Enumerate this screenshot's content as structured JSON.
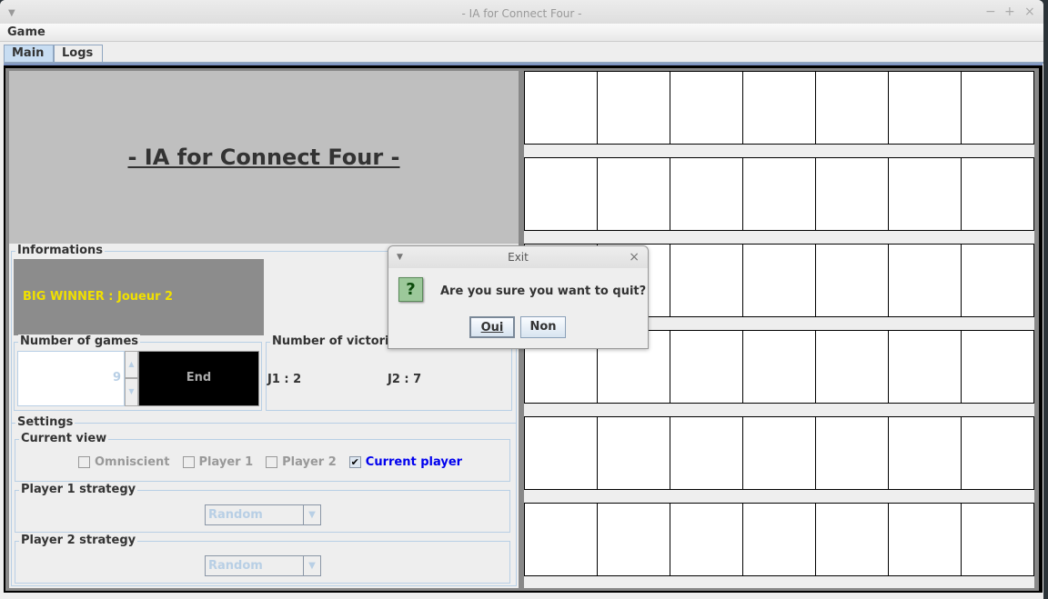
{
  "window": {
    "title": "- IA for Connect Four -",
    "controls": {
      "minimize": "−",
      "maximize": "+",
      "close": "×"
    }
  },
  "menu": {
    "items": [
      {
        "label": "Game"
      }
    ]
  },
  "tabs": [
    {
      "label": "Main",
      "active": true
    },
    {
      "label": "Logs",
      "active": false
    }
  ],
  "main": {
    "title": "- IA for Connect Four -",
    "informations": {
      "label": "Informations",
      "winner_text": "BIG WINNER : Joueur 2",
      "winner_color": "#f0e000"
    },
    "games": {
      "label": "Number of games",
      "value": "9",
      "end_button": "End"
    },
    "victories": {
      "label": "Number of victories",
      "j1": "J1 : 2",
      "j2": "J2 : 7"
    },
    "settings": {
      "label": "Settings",
      "current_view": {
        "label": "Current view",
        "options": [
          {
            "label": "Omniscient",
            "checked": false
          },
          {
            "label": "Player 1",
            "checked": false
          },
          {
            "label": "Player 2",
            "checked": false
          },
          {
            "label": "Current player",
            "checked": true
          }
        ]
      },
      "p1": {
        "label": "Player 1 strategy",
        "value": "Random"
      },
      "p2": {
        "label": "Player 2 strategy",
        "value": "Random"
      }
    }
  },
  "board": {
    "rows": 6,
    "cols": 7
  },
  "dialog": {
    "title": "Exit",
    "icon": "question-icon",
    "message": "Are you sure you want to quit?",
    "yes": "Oui",
    "no": "Non",
    "close": "×"
  }
}
